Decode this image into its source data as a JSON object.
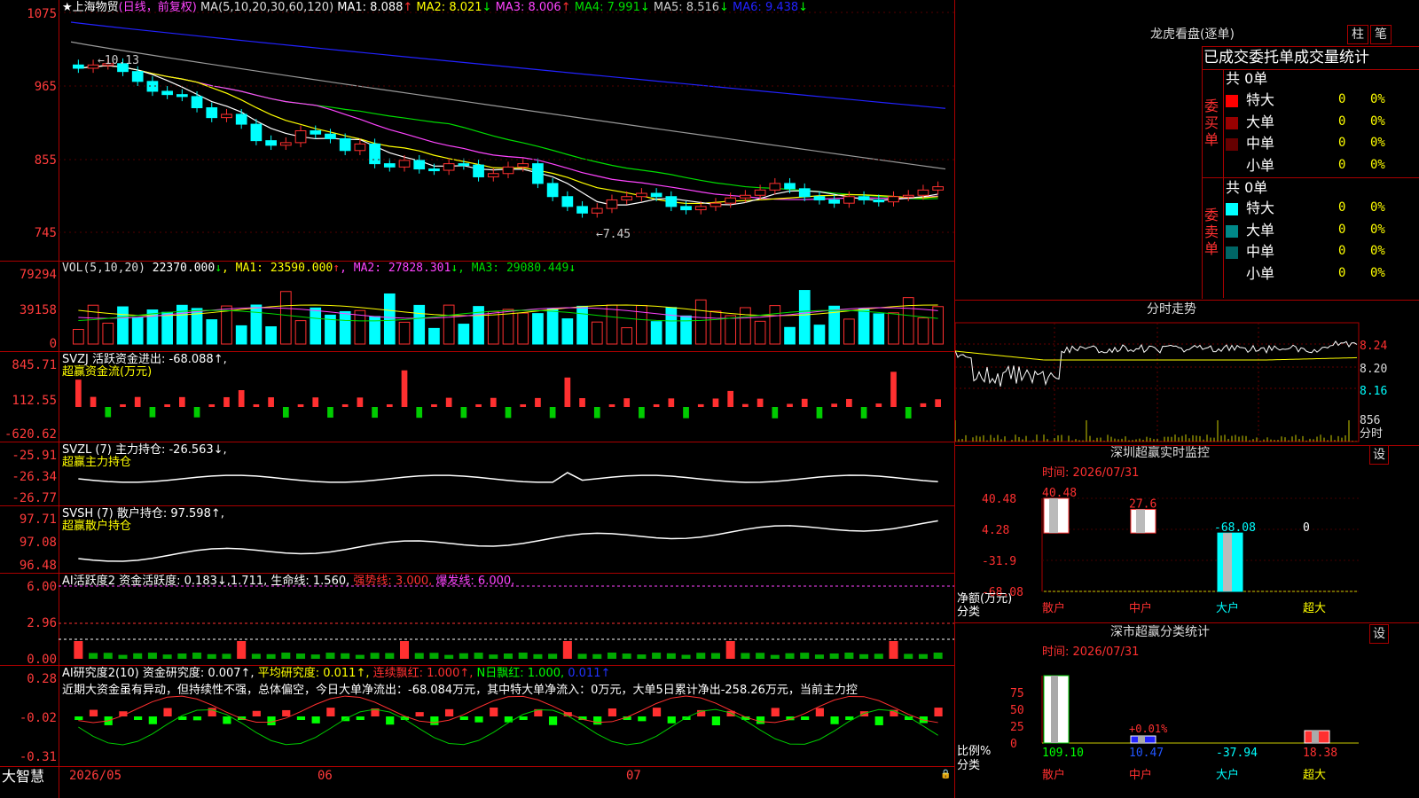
{
  "stock": {
    "name": "上海物贸",
    "period": "(日线，前复权)"
  },
  "kline": {
    "ma_line": "MA(5,10,20,30,60,120)",
    "ma": [
      {
        "name": "MA1:",
        "value": "8.088",
        "arrow": "↑",
        "color": "#ffffff"
      },
      {
        "name": "MA2:",
        "value": "8.021",
        "arrow": "↓",
        "color": "#ffff00"
      },
      {
        "name": "MA3:",
        "value": "8.006",
        "arrow": "↑",
        "color": "#ff44ff"
      },
      {
        "name": "MA4:",
        "value": "7.991",
        "arrow": "↓",
        "color": "#00dd00"
      },
      {
        "name": "MA5:",
        "value": "8.516",
        "arrow": "↓",
        "color": "#cccccc"
      },
      {
        "name": "MA6:",
        "value": "9.438",
        "arrow": "↓",
        "color": "#2222ff"
      }
    ],
    "yticks": [
      "1075",
      "965",
      "855",
      "745"
    ],
    "high_label": "←10.13",
    "low_label": "←7.45"
  },
  "vol": {
    "prefix": "VOL(5,10,20)",
    "value": "22370.000",
    "arrow": "↓",
    "ma": [
      {
        "name": "MA1:",
        "value": "23590.000",
        "arrow": "↑",
        "color": "#ffff00"
      },
      {
        "name": "MA2:",
        "value": "27828.301",
        "arrow": "↓",
        "color": "#ff44ff"
      },
      {
        "name": "MA3:",
        "value": "29080.449",
        "arrow": "↓",
        "color": "#00dd00"
      }
    ],
    "yticks": [
      "79294",
      "39158",
      "0"
    ]
  },
  "svzj": {
    "title": "SVZJ  活跃资金进出: -68.088↑,",
    "sub": "超赢资金流(万元)",
    "yticks": [
      "845.71",
      "112.55",
      "-620.62"
    ]
  },
  "svzl": {
    "title": "SVZL (7) 主力持仓: -26.563↓,",
    "sub": "超赢主力持仓",
    "yticks": [
      "-25.91",
      "-26.34",
      "-26.77"
    ]
  },
  "svsh": {
    "title": "SVSH (7) 散户持仓: 97.598↑,",
    "sub": "超赢散户持仓",
    "yticks": [
      "97.71",
      "97.08",
      "96.48"
    ]
  },
  "ai1": {
    "title": "AI活跃度2 资金活跃度: 0.183↓,",
    "v2": "1.711,",
    "v3": "生命线: 1.560,",
    "v4": "强势线: 3.000,",
    "v5": "爆发线: 6.000,",
    "yticks": [
      "6.00",
      "2.96",
      "0.00"
    ]
  },
  "ai2": {
    "title": "AI研究度2(10) 资金研究度: 0.007↑,",
    "v2": "平均研究度: 0.011↑,",
    "v3": "连续飘红: 1.000↑,",
    "v4": "N日飘红: 1.000,",
    "v5": "0.011↑",
    "yticks": [
      "0.28",
      "-0.02",
      "-0.31"
    ],
    "text": "近期大资金虽有异动，但持续性不强，总体偏空，今日大单净流出：-68.084万元，其中特大单净流入：0万元，大单5日累计净出-258.26万元，当前主力控"
  },
  "dates": [
    "2026/05",
    "06",
    "07"
  ],
  "brand": "大智慧",
  "right": {
    "title": "龙虎看盘(逐单)",
    "tab1": "柱",
    "tab2": "笔",
    "header": "已成交委托单成交量统计",
    "buy_label": "委买单",
    "sell_label": "委卖单",
    "buy_total": "共 0单",
    "sell_total": "共 0单",
    "rows_buy": [
      {
        "label": "特大",
        "count": "0",
        "pct": "0%",
        "color": "#ff0000"
      },
      {
        "label": "大单",
        "count": "0",
        "pct": "0%",
        "color": "#990000"
      },
      {
        "label": "中单",
        "count": "0",
        "pct": "0%",
        "color": "#660000"
      },
      {
        "label": "小单",
        "count": "0",
        "pct": "0%",
        "color": "#000000"
      }
    ],
    "rows_sell": [
      {
        "label": "特大",
        "count": "0",
        "pct": "0%",
        "color": "#00ffff"
      },
      {
        "label": "大单",
        "count": "0",
        "pct": "0%",
        "color": "#008888"
      },
      {
        "label": "中单",
        "count": "0",
        "pct": "0%",
        "color": "#006666"
      },
      {
        "label": "小单",
        "count": "0",
        "pct": "0%",
        "color": "#000000"
      }
    ],
    "intraday_title": "分时走势",
    "intraday_prices": [
      "8.24",
      "8.20",
      "8.16"
    ],
    "intraday_vol": "856",
    "intraday_vol_unit": "分时",
    "sz_title": "深圳超赢实时监控",
    "sz_setting": "设",
    "sz_time": "时间: 2026/07/31",
    "sz_yticks": [
      "40.48",
      "4.28",
      "-31.9",
      "-68.08"
    ],
    "sz_ylabel": "净额(万元)",
    "sz_xlabel": "分类",
    "sz_bars": [
      {
        "label": "散户",
        "value": 40.48,
        "text": "40.48"
      },
      {
        "label": "中户",
        "value": 27.6,
        "text": "27.6"
      },
      {
        "label": "大户",
        "value": -68.08,
        "text": "-68.08"
      },
      {
        "label": "超大",
        "value": 0,
        "text": "0"
      }
    ],
    "cls_title": "深市超赢分类统计",
    "cls_setting": "设",
    "cls_time": "时间: 2026/07/31",
    "cls_yticks": [
      "75",
      "50",
      "25",
      "0"
    ],
    "cls_ylabel": "比例%",
    "cls_xlabel": "分类",
    "cls_bars": [
      {
        "label": "散户",
        "value": 109.1,
        "text": "109.10"
      },
      {
        "label": "中户",
        "value": 10.47,
        "text": "10.47"
      },
      {
        "label": "大户",
        "value": -37.94,
        "text": "-37.94"
      },
      {
        "label": "超大",
        "value": 18.38,
        "text": "18.38"
      }
    ],
    "cls_note": "+0.01%"
  },
  "colors": {
    "up": "#ff3030",
    "down": "#00ffff",
    "grid": "#aa0000",
    "axis": "#ff3b3b"
  }
}
